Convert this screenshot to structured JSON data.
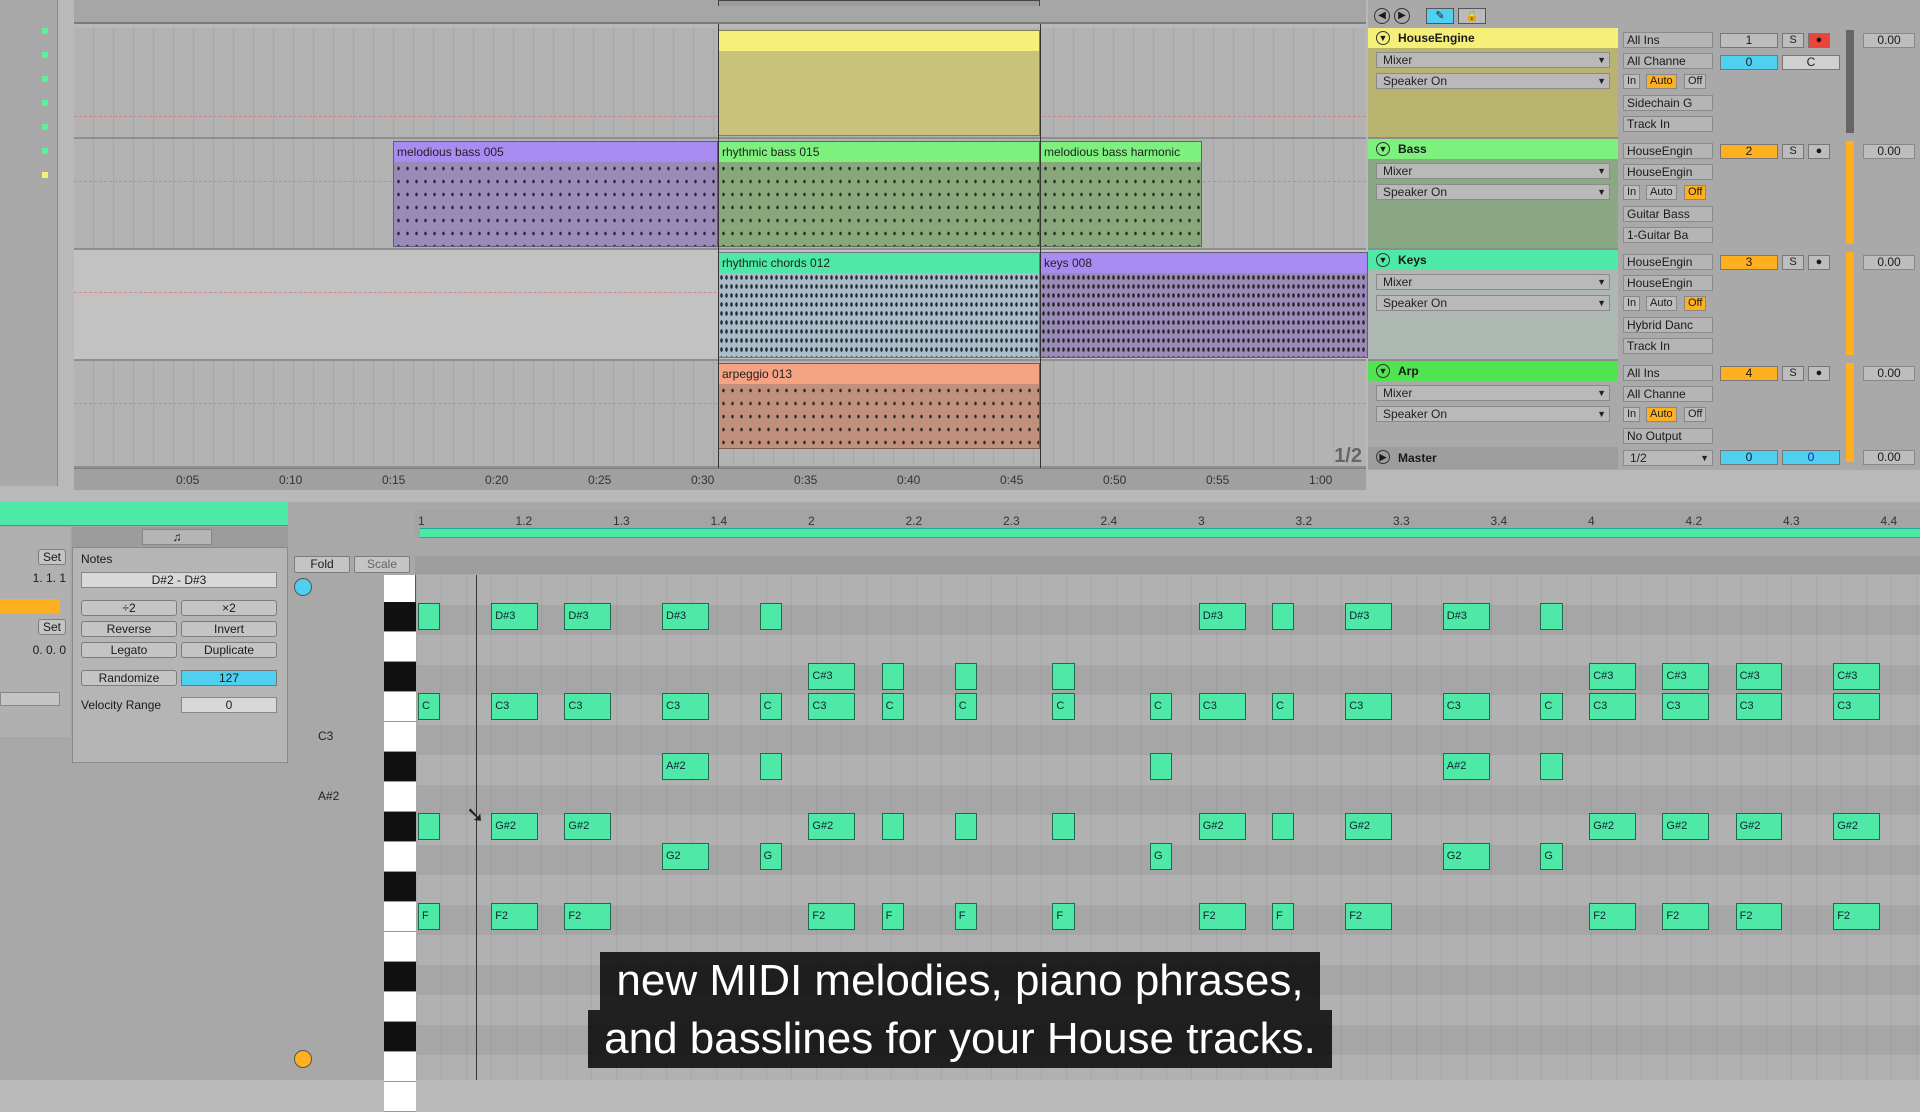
{
  "arrangement": {
    "tracks": [
      {
        "name": "HouseEngine",
        "color": "#f6f07a",
        "clips": [
          {
            "name": "",
            "color": "#f6f07a"
          }
        ],
        "routing": [
          "Mixer",
          "Speaker On"
        ],
        "in": "All Ins",
        "chan": "All Channe",
        "num": "1",
        "monitor": "Auto",
        "extra": [
          "Sidechain G",
          "Track In"
        ],
        "vol": "0.00",
        "send": "0",
        "pan": "C"
      },
      {
        "name": "Bass",
        "color": "#7ef07e",
        "clips": [
          {
            "name": "melodious bass 005",
            "color": "#a98cf2"
          },
          {
            "name": "rhythmic bass 015",
            "color": "#7ef07e"
          },
          {
            "name": "melodious bass harmonic",
            "color": "#7ef07e"
          }
        ],
        "routing": [
          "Mixer",
          "Speaker On"
        ],
        "in": "HouseEngin",
        "chan": "HouseEngin",
        "num": "2",
        "monitor": "Off",
        "extra": [
          "Guitar Bass",
          "1-Guitar Ba"
        ],
        "vol": "0.00"
      },
      {
        "name": "Keys",
        "color": "#4ee9a6",
        "clips": [
          {
            "name": "rhythmic chords 012",
            "color": "#4ee9a6"
          },
          {
            "name": "keys 008",
            "color": "#a98cf2"
          }
        ],
        "routing": [
          "Mixer",
          "Speaker On"
        ],
        "in": "HouseEngin",
        "chan": "HouseEngin",
        "num": "3",
        "monitor": "Off",
        "extra": [
          "Hybrid Danc",
          "Track In"
        ],
        "vol": "0.00"
      },
      {
        "name": "Arp",
        "color": "#50e550",
        "clips": [
          {
            "name": "arpeggio 013",
            "color": "#f5a383"
          }
        ],
        "routing": [
          "Mixer",
          "Speaker On"
        ],
        "in": "All Ins",
        "chan": "All Channe",
        "num": "4",
        "monitor": "Auto",
        "extra": [
          "No Output"
        ],
        "vol": "0.00"
      }
    ],
    "timeline": [
      "0:05",
      "0:10",
      "0:15",
      "0:20",
      "0:25",
      "0:30",
      "0:35",
      "0:40",
      "0:45",
      "0:50",
      "0:55",
      "1:00"
    ],
    "page": "1/2",
    "master": {
      "name": "Master",
      "quant": "1/2",
      "a": "0",
      "b": "0",
      "vol": "0.00"
    },
    "monitor_labels": {
      "in": "In",
      "auto": "Auto",
      "off": "Off"
    },
    "solo": "S"
  },
  "clip_view": {
    "notes_label": "Notes",
    "range": "D#2 - D#3",
    "buttons": [
      "÷2",
      "×2",
      "Reverse",
      "Invert",
      "Legato",
      "Duplicate"
    ],
    "randomize": "Randomize",
    "randomize_value": "127",
    "velocity_range_label": "Velocity Range",
    "velocity_range_value": "0",
    "set": "Set",
    "pos1": "1.  1.  1",
    "pos2": "0.  0.  0",
    "fold": "Fold",
    "scale": "Scale",
    "ruler": [
      "1",
      "1.2",
      "1.3",
      "1.4",
      "2",
      "2.2",
      "2.3",
      "2.4",
      "3",
      "3.2",
      "3.3",
      "3.4",
      "4",
      "4.2",
      "4.3",
      "4.4"
    ],
    "key_labels": [
      "C3",
      "A#2"
    ]
  },
  "piano_roll": {
    "notes": [
      {
        "p": "D#3",
        "s": 0,
        "l": 1,
        "t": ""
      },
      {
        "p": "D#3",
        "s": 3,
        "l": 2,
        "t": "D#3"
      },
      {
        "p": "D#3",
        "s": 6,
        "l": 2,
        "t": "D#3"
      },
      {
        "p": "D#3",
        "s": 10,
        "l": 2,
        "t": "D#3"
      },
      {
        "p": "D#3",
        "s": 14,
        "l": 1,
        "t": ""
      },
      {
        "p": "D#3",
        "s": 32,
        "l": 2,
        "t": "D#3"
      },
      {
        "p": "D#3",
        "s": 35,
        "l": 1,
        "t": ""
      },
      {
        "p": "D#3",
        "s": 38,
        "l": 2,
        "t": "D#3"
      },
      {
        "p": "D#3",
        "s": 42,
        "l": 2,
        "t": "D#3"
      },
      {
        "p": "D#3",
        "s": 46,
        "l": 1,
        "t": ""
      },
      {
        "p": "C#3",
        "s": 16,
        "l": 2,
        "t": "C#3"
      },
      {
        "p": "C#3",
        "s": 19,
        "l": 1,
        "t": ""
      },
      {
        "p": "C#3",
        "s": 22,
        "l": 1,
        "t": ""
      },
      {
        "p": "C#3",
        "s": 26,
        "l": 1,
        "t": ""
      },
      {
        "p": "C#3",
        "s": 48,
        "l": 2,
        "t": "C#3"
      },
      {
        "p": "C#3",
        "s": 51,
        "l": 2,
        "t": "C#3"
      },
      {
        "p": "C#3",
        "s": 54,
        "l": 2,
        "t": "C#3"
      },
      {
        "p": "C#3",
        "s": 58,
        "l": 2,
        "t": "C#3"
      },
      {
        "p": "C3",
        "s": 0,
        "l": 1,
        "t": "C"
      },
      {
        "p": "C3",
        "s": 3,
        "l": 2,
        "t": "C3"
      },
      {
        "p": "C3",
        "s": 6,
        "l": 2,
        "t": "C3"
      },
      {
        "p": "C3",
        "s": 10,
        "l": 2,
        "t": "C3"
      },
      {
        "p": "C3",
        "s": 14,
        "l": 1,
        "t": "C"
      },
      {
        "p": "C3",
        "s": 16,
        "l": 2,
        "t": "C3"
      },
      {
        "p": "C3",
        "s": 19,
        "l": 1,
        "t": "C"
      },
      {
        "p": "C3",
        "s": 22,
        "l": 1,
        "t": "C"
      },
      {
        "p": "C3",
        "s": 26,
        "l": 1,
        "t": "C"
      },
      {
        "p": "C3",
        "s": 30,
        "l": 1,
        "t": "C"
      },
      {
        "p": "C3",
        "s": 32,
        "l": 2,
        "t": "C3"
      },
      {
        "p": "C3",
        "s": 35,
        "l": 1,
        "t": "C"
      },
      {
        "p": "C3",
        "s": 38,
        "l": 2,
        "t": "C3"
      },
      {
        "p": "C3",
        "s": 42,
        "l": 2,
        "t": "C3"
      },
      {
        "p": "C3",
        "s": 46,
        "l": 1,
        "t": "C"
      },
      {
        "p": "C3",
        "s": 48,
        "l": 2,
        "t": "C3"
      },
      {
        "p": "C3",
        "s": 51,
        "l": 2,
        "t": "C3"
      },
      {
        "p": "C3",
        "s": 54,
        "l": 2,
        "t": "C3"
      },
      {
        "p": "C3",
        "s": 58,
        "l": 2,
        "t": "C3"
      },
      {
        "p": "A#2",
        "s": 10,
        "l": 2,
        "t": "A#2"
      },
      {
        "p": "A#2",
        "s": 14,
        "l": 1,
        "t": ""
      },
      {
        "p": "A#2",
        "s": 30,
        "l": 1,
        "t": ""
      },
      {
        "p": "A#2",
        "s": 42,
        "l": 2,
        "t": "A#2"
      },
      {
        "p": "A#2",
        "s": 46,
        "l": 1,
        "t": ""
      },
      {
        "p": "G#2",
        "s": 0,
        "l": 1,
        "t": ""
      },
      {
        "p": "G#2",
        "s": 3,
        "l": 2,
        "t": "G#2"
      },
      {
        "p": "G#2",
        "s": 6,
        "l": 2,
        "t": "G#2"
      },
      {
        "p": "G#2",
        "s": 16,
        "l": 2,
        "t": "G#2"
      },
      {
        "p": "G#2",
        "s": 19,
        "l": 1,
        "t": ""
      },
      {
        "p": "G#2",
        "s": 22,
        "l": 1,
        "t": ""
      },
      {
        "p": "G#2",
        "s": 26,
        "l": 1,
        "t": ""
      },
      {
        "p": "G#2",
        "s": 32,
        "l": 2,
        "t": "G#2"
      },
      {
        "p": "G#2",
        "s": 35,
        "l": 1,
        "t": ""
      },
      {
        "p": "G#2",
        "s": 38,
        "l": 2,
        "t": "G#2"
      },
      {
        "p": "G#2",
        "s": 48,
        "l": 2,
        "t": "G#2"
      },
      {
        "p": "G#2",
        "s": 51,
        "l": 2,
        "t": "G#2"
      },
      {
        "p": "G#2",
        "s": 54,
        "l": 2,
        "t": "G#2"
      },
      {
        "p": "G#2",
        "s": 58,
        "l": 2,
        "t": "G#2"
      },
      {
        "p": "G2",
        "s": 10,
        "l": 2,
        "t": "G2"
      },
      {
        "p": "G2",
        "s": 14,
        "l": 1,
        "t": "G"
      },
      {
        "p": "G2",
        "s": 30,
        "l": 1,
        "t": "G"
      },
      {
        "p": "G2",
        "s": 42,
        "l": 2,
        "t": "G2"
      },
      {
        "p": "G2",
        "s": 46,
        "l": 1,
        "t": "G"
      },
      {
        "p": "F2",
        "s": 0,
        "l": 1,
        "t": "F"
      },
      {
        "p": "F2",
        "s": 3,
        "l": 2,
        "t": "F2"
      },
      {
        "p": "F2",
        "s": 6,
        "l": 2,
        "t": "F2"
      },
      {
        "p": "F2",
        "s": 16,
        "l": 2,
        "t": "F2"
      },
      {
        "p": "F2",
        "s": 19,
        "l": 1,
        "t": "F"
      },
      {
        "p": "F2",
        "s": 22,
        "l": 1,
        "t": "F"
      },
      {
        "p": "F2",
        "s": 26,
        "l": 1,
        "t": "F"
      },
      {
        "p": "F2",
        "s": 32,
        "l": 2,
        "t": "F2"
      },
      {
        "p": "F2",
        "s": 35,
        "l": 1,
        "t": "F"
      },
      {
        "p": "F2",
        "s": 38,
        "l": 2,
        "t": "F2"
      },
      {
        "p": "F2",
        "s": 48,
        "l": 2,
        "t": "F2"
      },
      {
        "p": "F2",
        "s": 51,
        "l": 2,
        "t": "F2"
      },
      {
        "p": "F2",
        "s": 54,
        "l": 2,
        "t": "F2"
      },
      {
        "p": "F2",
        "s": 58,
        "l": 2,
        "t": "F2"
      }
    ]
  },
  "subtitles": [
    "new MIDI melodies, piano phrases,",
    "and basslines for your House tracks."
  ],
  "colors": {
    "accent": "#4ee9a6",
    "yellow": "#f6f07a",
    "orange": "#ffb020",
    "cyan": "#4fd0f0",
    "red": "#e8443a"
  }
}
